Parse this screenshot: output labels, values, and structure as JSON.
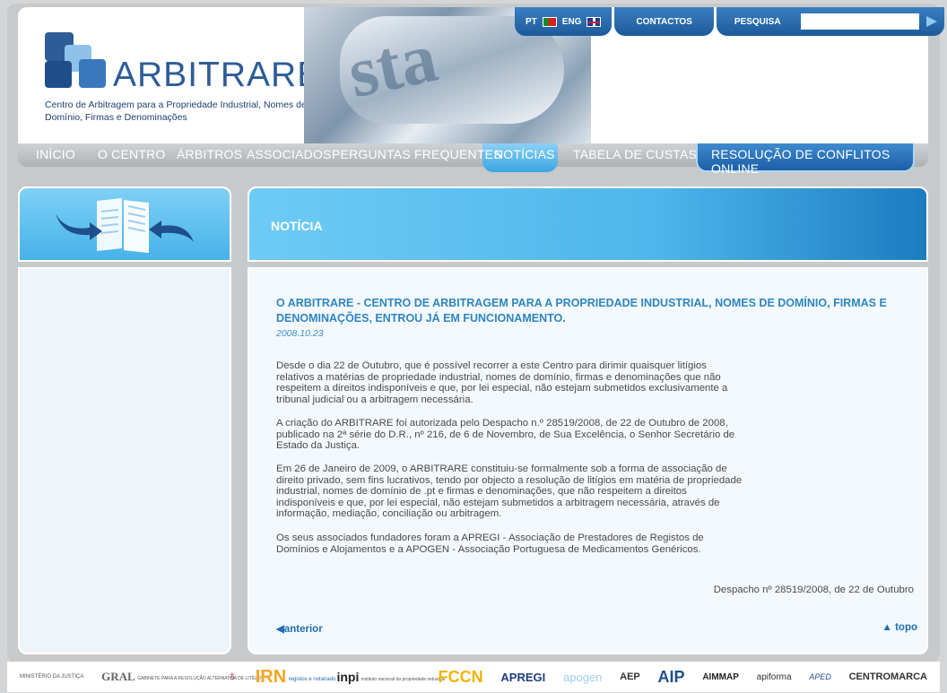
{
  "brand": {
    "name": "ARBITRARE",
    "subtitle": "Centro de Arbitragem para a Propriedade Industrial, Nomes de Domínio, Firmas e Denominações"
  },
  "topbar": {
    "lang_pt": "PT",
    "lang_en": "ENG",
    "contactos": "CONTACTOS",
    "pesquisa": "PESQUISA",
    "search_value": ""
  },
  "nav": {
    "inicio": "INÍCIO",
    "o_centro": "O CENTRO",
    "arbitros": "ÁRBITROS",
    "associados": "ASSOCIADOS",
    "perguntas": "PERGUNTAS FREQUENTES",
    "noticias": "NOTÍCIAS",
    "tabela": "TABELA DE CUSTAS",
    "online": "RESOLUÇÃO DE CONFLITOS ONLINE"
  },
  "section_title": "NOTÍCIA",
  "article": {
    "headline": "O ARBITRARE - CENTRO DE ARBITRAGEM PARA A PROPRIEDADE INDUSTRIAL, NOMES DE DOMÍNIO, FIRMAS E DENOMINAÇÕES, ENTROU JÁ EM FUNCIONAMENTO.",
    "date": "2008.10.23",
    "p1": "Desde o dia 22 de Outubro, que é possível recorrer a este Centro para dirimir quaisquer litígios relativos a matérias de propriedade industrial, nomes de domínio, firmas e denominações que não respeitem a direitos indisponíveis e que, por lei especial, não estejam submetidos exclusivamente a tribunal judicial ou a arbitragem necessária.",
    "p2": "A criação do ARBITRARE foi autorizada pelo Despacho n.º 28519/2008, de 22 de Outubro de 2008, publicado na 2ª série do D.R., nº 216, de 6 de Novembro, de Sua Excelência, o Senhor Secretário de Estado da Justiça.",
    "p3": "Em 26 de Janeiro de 2009, o ARBITRARE constituiu-se formalmente sob a forma de associação de direito privado, sem fins lucrativos, tendo por objecto a resolução de litígios em matéria de propriedade industrial, nomes de domínio de .pt e firmas e denominações, que não respeitem a direitos indisponíveis e que, por lei especial, não estejam submetidos a arbitragem necessária, através de informação, mediação, conciliação ou arbitragem.",
    "p4": "Os seus associados fundadores foram a APREGI - Associação de Prestadores de Registos de Domínios e Alojamentos e a APOGEN - Associação Portuguesa de Medicamentos Genéricos.",
    "reference": "Despacho nº 28519/2008, de 22 de Outubro",
    "prev": "anterior",
    "top": "topo"
  },
  "partners": {
    "mj": "MINISTÉRIO DA JUSTIÇA",
    "gral": "GRAL",
    "gral_sub": "GABINETE PARA A RESOLUÇÃO ALTERNATIVA DE LITÍGIOS",
    "irn": "IRN",
    "irn_sub": "registos e notariado",
    "inpi": "inpi",
    "inpi_sub": "instituto nacional da propriedade industrial",
    "fccn": "FCCN",
    "apregi": "APREGI",
    "apogen": "apogen",
    "aep": "AEP",
    "aip": "AIP",
    "aimmap": "AIMMAP",
    "apiforma": "apiforma",
    "aped": "APED",
    "centromarca": "CENTROMARCA"
  },
  "colors": {
    "brand_blue": "#2e5c97",
    "accent": "#3aa6e3",
    "headline": "#2f86c0"
  }
}
